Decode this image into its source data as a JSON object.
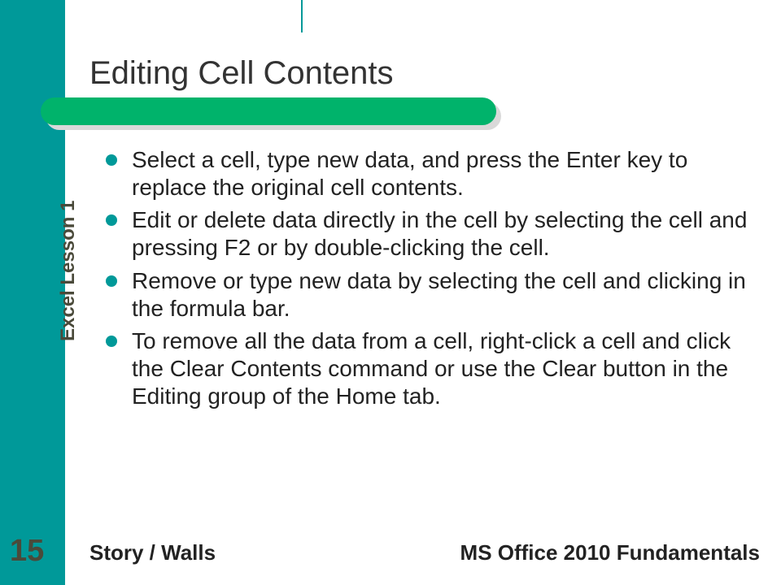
{
  "title": "Editing Cell Contents",
  "bullets": [
    "Select a cell, type new data, and press the Enter key to replace the original cell contents.",
    "Edit or delete data directly in the cell by selecting the cell and pressing F2 or by double-clicking the cell.",
    "Remove or type new data by selecting the cell and clicking in the formula bar.",
    "To remove all the data from a cell, right-click a cell and click the Clear Contents command or use the Clear button in the Editing group of the Home tab."
  ],
  "side_label": "Excel Lesson 1",
  "page_number": "15",
  "footer_left": "Story / Walls",
  "footer_right": "MS Office 2010 Fundamentals"
}
